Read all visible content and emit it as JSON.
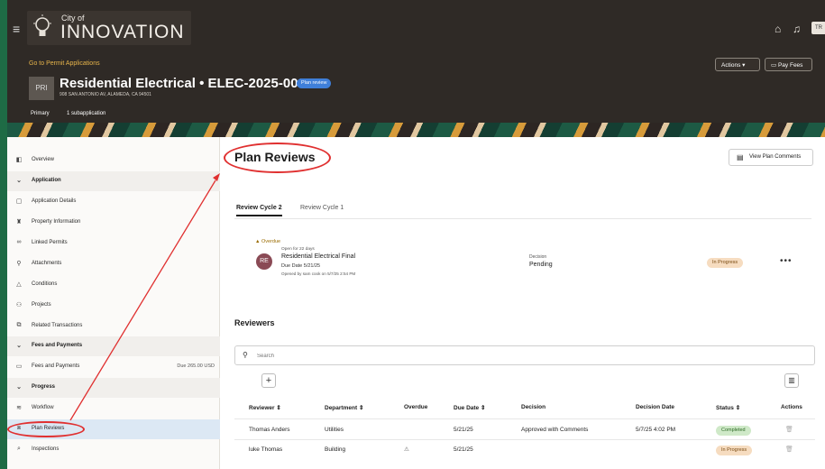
{
  "header": {
    "city_of": "City of",
    "brand": "INNOVATION",
    "go_link": "Go to Permit Applications",
    "actions_label": "Actions",
    "pay_fees_label": "Pay Fees",
    "pri_label": "PRI",
    "title": "Residential Electrical • ELEC-2025-00002",
    "badge": "Plan review",
    "address": "908 SAN ANTONIO AV, ALAMEDA, CA 94501",
    "primary_tab": "Primary",
    "subapp_tab": "1 subapplication",
    "avatar_initials": "TR"
  },
  "sidebar": {
    "items": [
      {
        "label": "Overview",
        "icon": "overview-icon",
        "glyph": "◧"
      },
      {
        "label": "Application",
        "section": true,
        "glyph": "⌄"
      },
      {
        "label": "Application Details",
        "icon": "document-icon",
        "glyph": "▢"
      },
      {
        "label": "Property Information",
        "icon": "property-icon",
        "glyph": "♜"
      },
      {
        "label": "Linked Permits",
        "icon": "link-icon",
        "glyph": "∞"
      },
      {
        "label": "Attachments",
        "icon": "attachment-icon",
        "glyph": "⚲"
      },
      {
        "label": "Conditions",
        "icon": "warning-icon",
        "glyph": "△"
      },
      {
        "label": "Projects",
        "icon": "projects-icon",
        "glyph": "⚇"
      },
      {
        "label": "Related Transactions",
        "icon": "transactions-icon",
        "glyph": "⧉"
      },
      {
        "label": "Fees and Payments",
        "section": true,
        "glyph": "⌄"
      },
      {
        "label": "Fees and Payments",
        "icon": "fees-icon",
        "glyph": "▭",
        "due": "Due 265.00 USD"
      },
      {
        "label": "Progress",
        "section": true,
        "glyph": "⌄"
      },
      {
        "label": "Workflow",
        "icon": "workflow-icon",
        "glyph": "≋"
      },
      {
        "label": "Plan Reviews",
        "icon": "plan-review-icon",
        "glyph": "⧈",
        "active": true
      },
      {
        "label": "Inspections",
        "icon": "inspections-icon",
        "glyph": "⌕"
      }
    ]
  },
  "main": {
    "title": "Plan Reviews",
    "view_comments": "View Plan Comments",
    "tabs": [
      "Review Cycle 2",
      "Review Cycle 1"
    ],
    "review": {
      "overdue": "Overdue",
      "open_for": "Open for 22 days",
      "avatar_initials": "RE",
      "title": "Residential Electrical Final",
      "due_date": "Due Date 5/21/25",
      "opened_by": "Opened by sam cook on 5/7/25 2:54 PM",
      "decision_label": "Decision",
      "decision_value": "Pending",
      "status": "In Progress"
    },
    "reviewers_title": "Reviewers",
    "search_placeholder": "Search",
    "columns": [
      "Reviewer",
      "Department",
      "Overdue",
      "Due Date",
      "Decision",
      "Decision Date",
      "Status",
      "Actions"
    ],
    "rows": [
      {
        "reviewer": "Thomas Anders",
        "department": "Utilities",
        "overdue": "",
        "due": "5/21/25",
        "decision": "Approved with Comments",
        "decision_date": "5/7/25 4:02 PM",
        "status": "Completed"
      },
      {
        "reviewer": "luke Thomas",
        "department": "Building",
        "overdue": "⚠",
        "due": "5/21/25",
        "decision": "",
        "decision_date": "",
        "status": "In Progress"
      }
    ]
  },
  "colors": {
    "accent_red": "#e03030",
    "header_bg": "#2f2a26",
    "link_gold": "#e8b54b",
    "badge_blue": "#3f7fd9"
  }
}
